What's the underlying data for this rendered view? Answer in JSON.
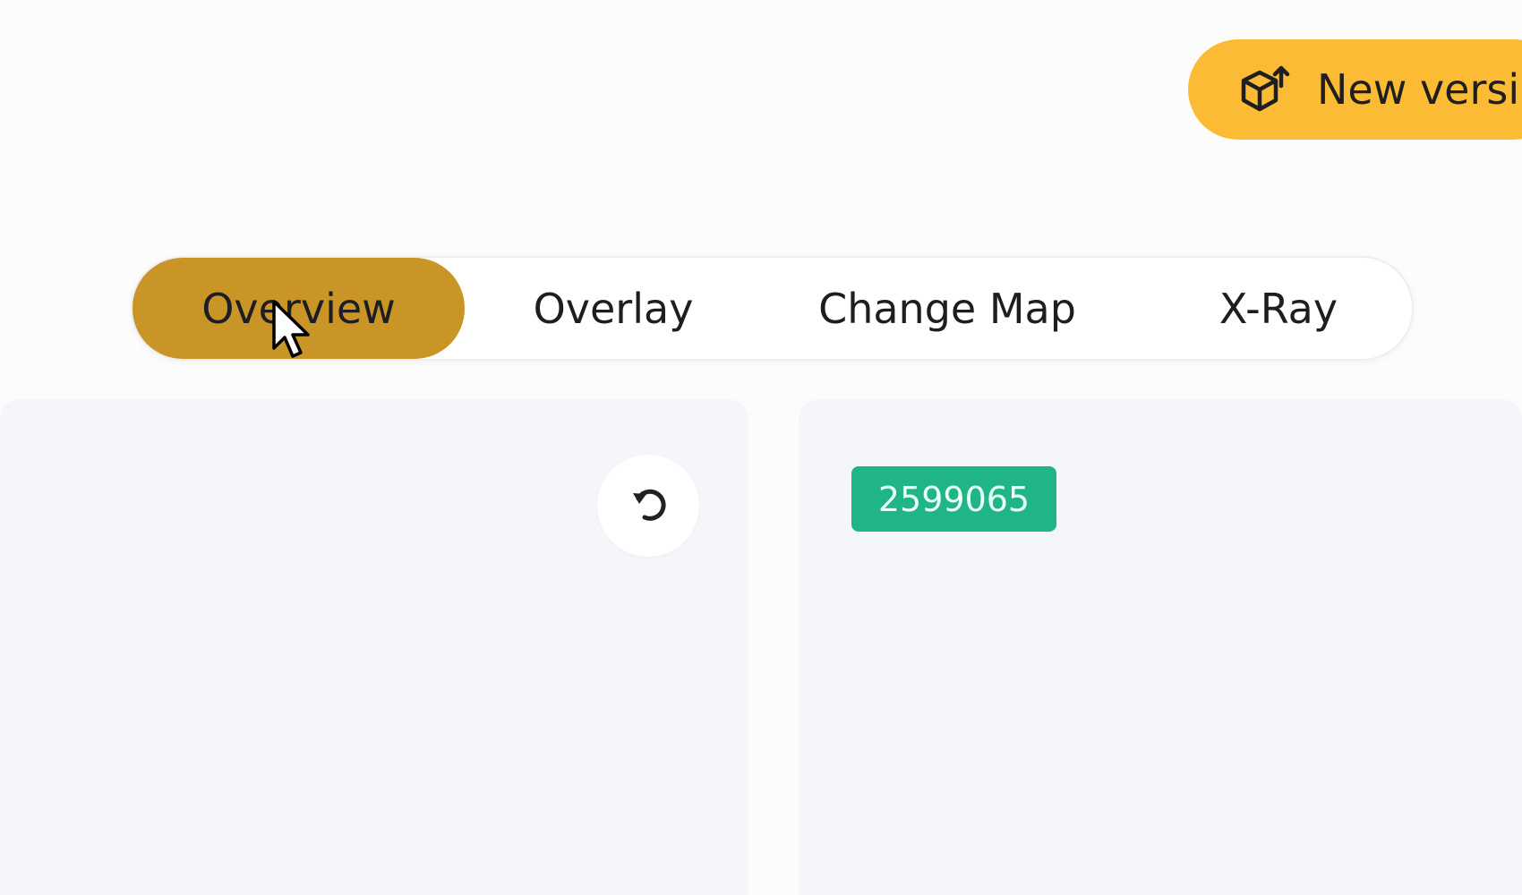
{
  "header": {
    "new_version_label": "New versi",
    "new_version_icon": "package-upgrade-icon"
  },
  "tabs": [
    {
      "label": "Overview",
      "active": true
    },
    {
      "label": "Overlay",
      "active": false
    },
    {
      "label": "Change Map",
      "active": false
    },
    {
      "label": "X-Ray",
      "active": false
    }
  ],
  "left_panel": {
    "refresh_icon": "refresh-icon"
  },
  "right_panel": {
    "id_badge": "2599065"
  },
  "colors": {
    "new_version_bg": "#fbbb35",
    "active_tab_bg": "#c99527",
    "id_badge_bg": "#1fb586",
    "panel_bg": "#f5f6f9"
  }
}
